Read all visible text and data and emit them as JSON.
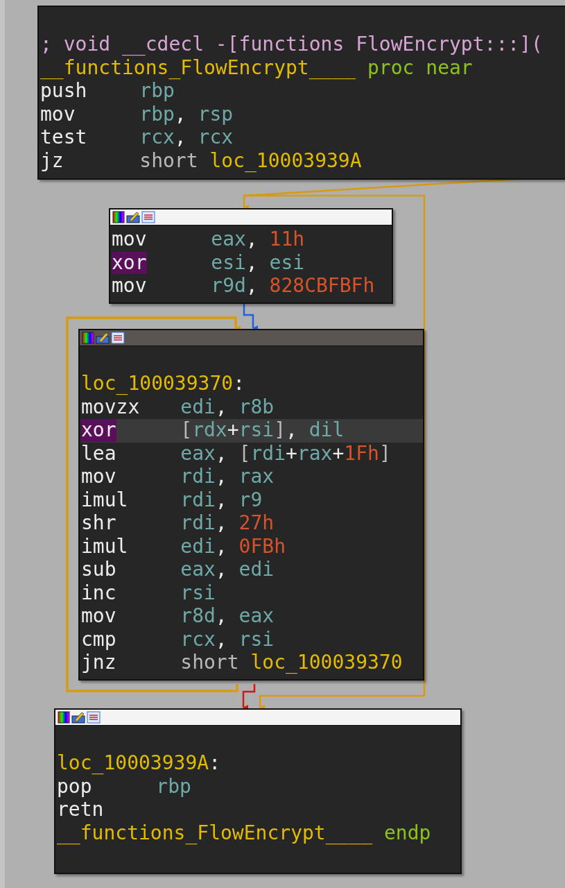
{
  "blocks": [
    {
      "lines": [
        {
          "tokens": [
            {
              "kind": "comment",
              "text": "; void __cdecl -[functions FlowEncrypt:::]("
            }
          ]
        },
        {
          "tokens": [
            {
              "kind": "name",
              "text": "__functions_FlowEncrypt____"
            },
            {
              "kind": "keyword",
              "text": "proc near"
            }
          ]
        },
        {
          "tokens": [
            {
              "kind": "mnemonic",
              "text": "push"
            },
            {
              "kind": "register",
              "text": "rbp"
            }
          ]
        },
        {
          "tokens": [
            {
              "kind": "mnemonic",
              "text": "mov"
            },
            {
              "kind": "register",
              "text": "rbp"
            },
            {
              "kind": "punct",
              "text": ","
            },
            {
              "kind": "register",
              "text": "rsp"
            }
          ]
        },
        {
          "tokens": [
            {
              "kind": "mnemonic",
              "text": "test"
            },
            {
              "kind": "register",
              "text": "rcx"
            },
            {
              "kind": "punct",
              "text": ","
            },
            {
              "kind": "register",
              "text": "rcx"
            }
          ]
        },
        {
          "tokens": [
            {
              "kind": "mnemonic",
              "text": "jz"
            },
            {
              "kind": "plain",
              "text": "short"
            },
            {
              "kind": "name",
              "text": "loc_10003939A"
            }
          ]
        }
      ]
    },
    {
      "selected": false,
      "lines": [
        {
          "tokens": [
            {
              "kind": "mnemonic",
              "text": "mov"
            },
            {
              "kind": "register",
              "text": "eax"
            },
            {
              "kind": "punct",
              "text": ","
            },
            {
              "kind": "number",
              "text": "11h"
            }
          ]
        },
        {
          "tokens": [
            {
              "kind": "marked_mnemonic",
              "text": "xor"
            },
            {
              "kind": "register",
              "text": "esi"
            },
            {
              "kind": "punct",
              "text": ","
            },
            {
              "kind": "register",
              "text": "esi"
            }
          ]
        },
        {
          "tokens": [
            {
              "kind": "mnemonic",
              "text": "mov"
            },
            {
              "kind": "register",
              "text": "r9d"
            },
            {
              "kind": "punct",
              "text": ","
            },
            {
              "kind": "number",
              "text": "828CBFBFh"
            }
          ]
        }
      ]
    },
    {
      "selected": true,
      "lines": [
        {
          "current": false,
          "tokens": [
            {
              "kind": "name",
              "text": "loc_100039370"
            },
            {
              "kind": "punct",
              "text": ":"
            }
          ]
        },
        {
          "current": false,
          "tokens": [
            {
              "kind": "mnemonic",
              "text": "movzx"
            },
            {
              "kind": "register",
              "text": "edi"
            },
            {
              "kind": "punct",
              "text": ","
            },
            {
              "kind": "register",
              "text": "r8b"
            }
          ]
        },
        {
          "current": true,
          "tokens": [
            {
              "kind": "marked_mnemonic",
              "text": "xor"
            },
            {
              "kind": "plain",
              "text": "["
            },
            {
              "kind": "register",
              "text": "rdx"
            },
            {
              "kind": "sign",
              "text": "+"
            },
            {
              "kind": "register",
              "text": "rsi"
            },
            {
              "kind": "plain",
              "text": "]"
            },
            {
              "kind": "punct",
              "text": ","
            },
            {
              "kind": "register",
              "text": "dil"
            }
          ]
        },
        {
          "current": false,
          "tokens": [
            {
              "kind": "mnemonic",
              "text": "lea"
            },
            {
              "kind": "register",
              "text": "eax"
            },
            {
              "kind": "punct",
              "text": ","
            },
            {
              "kind": "opening",
              "text": "["
            },
            {
              "kind": "register",
              "text": "rdi"
            },
            {
              "kind": "sign",
              "text": "+"
            },
            {
              "kind": "register",
              "text": "rax"
            },
            {
              "kind": "sign",
              "text": "+"
            },
            {
              "kind": "number",
              "text": "1Fh"
            },
            {
              "kind": "plain",
              "text": "]"
            }
          ]
        },
        {
          "current": false,
          "tokens": [
            {
              "kind": "mnemonic",
              "text": "mov"
            },
            {
              "kind": "register",
              "text": "rdi"
            },
            {
              "kind": "punct",
              "text": ","
            },
            {
              "kind": "register",
              "text": "rax"
            }
          ]
        },
        {
          "current": false,
          "tokens": [
            {
              "kind": "mnemonic",
              "text": "imul"
            },
            {
              "kind": "register",
              "text": "rdi"
            },
            {
              "kind": "punct",
              "text": ","
            },
            {
              "kind": "register",
              "text": "r9"
            }
          ]
        },
        {
          "current": false,
          "tokens": [
            {
              "kind": "mnemonic",
              "text": "shr"
            },
            {
              "kind": "register",
              "text": "rdi"
            },
            {
              "kind": "punct",
              "text": ","
            },
            {
              "kind": "number",
              "text": "27h"
            }
          ]
        },
        {
          "current": false,
          "tokens": [
            {
              "kind": "mnemonic",
              "text": "imul"
            },
            {
              "kind": "register",
              "text": "edi"
            },
            {
              "kind": "punct",
              "text": ","
            },
            {
              "kind": "number",
              "text": "0FBh"
            }
          ]
        },
        {
          "current": false,
          "tokens": [
            {
              "kind": "mnemonic",
              "text": "sub"
            },
            {
              "kind": "register",
              "text": "eax"
            },
            {
              "kind": "punct",
              "text": ","
            },
            {
              "kind": "register",
              "text": "edi"
            }
          ]
        },
        {
          "current": false,
          "tokens": [
            {
              "kind": "mnemonic",
              "text": "inc"
            },
            {
              "kind": "register",
              "text": "rsi"
            }
          ]
        },
        {
          "current": false,
          "tokens": [
            {
              "kind": "mnemonic",
              "text": "mov"
            },
            {
              "kind": "register",
              "text": "r8d"
            },
            {
              "kind": "punct",
              "text": ","
            },
            {
              "kind": "register",
              "text": "eax"
            }
          ]
        },
        {
          "current": false,
          "tokens": [
            {
              "kind": "mnemonic",
              "text": "cmp"
            },
            {
              "kind": "register",
              "text": "rcx"
            },
            {
              "kind": "punct",
              "text": ","
            },
            {
              "kind": "register",
              "text": "rsi"
            }
          ]
        },
        {
          "current": false,
          "tokens": [
            {
              "kind": "mnemonic",
              "text": "jnz"
            },
            {
              "kind": "plain",
              "text": "short"
            },
            {
              "kind": "name",
              "text": "loc_100039370"
            }
          ]
        }
      ]
    },
    {
      "selected": false,
      "lines": [
        {
          "tokens": [
            {
              "kind": "name",
              "text": "loc_10003939A"
            },
            {
              "kind": "punct",
              "text": ":"
            }
          ]
        },
        {
          "tokens": [
            {
              "kind": "mnemonic",
              "text": "pop"
            },
            {
              "kind": "register",
              "text": "rbp"
            }
          ]
        },
        {
          "tokens": [
            {
              "kind": "mnemonic",
              "text": "retn"
            }
          ]
        },
        {
          "tokens": [
            {
              "kind": "name",
              "text": "__functions_FlowEncrypt____"
            },
            {
              "kind": "keyword",
              "text": "endp"
            }
          ]
        }
      ]
    }
  ]
}
